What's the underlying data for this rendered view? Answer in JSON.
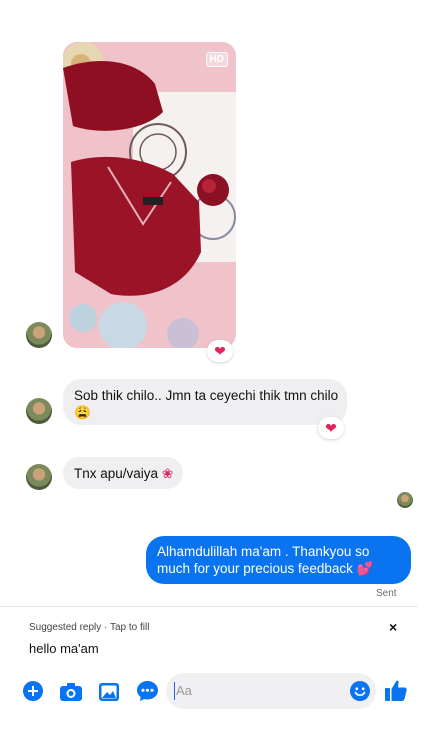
{
  "photo": {
    "badge": "HD",
    "reaction": "❤"
  },
  "messages": [
    {
      "text": "Sob thik chilo.. Jmn ta ceyechi thik tmn chilo",
      "emoji": "😩",
      "reaction": "❤"
    },
    {
      "text": "Tnx apu/vaiya",
      "emoji": "❀"
    }
  ],
  "outgoing": {
    "text": "Alhamdulillah ma'am . Thankyou so much for your precious feedback",
    "emoji": "💕",
    "status": "Sent"
  },
  "suggested": {
    "label": "Suggested reply · Tap to fill",
    "text": "hello ma'am",
    "close": "×"
  },
  "composer": {
    "placeholder": "Aa"
  },
  "colors": {
    "accent": "#0a73f0",
    "incoming_bubble": "#efeff1",
    "heart": "#e0245e"
  }
}
